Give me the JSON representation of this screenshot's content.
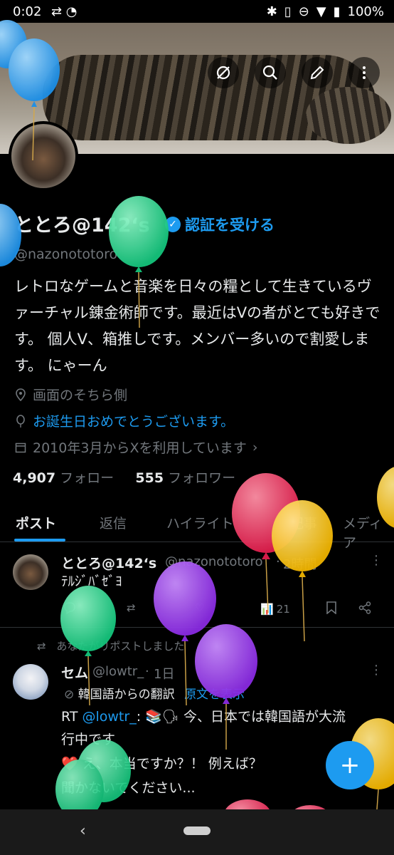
{
  "status_bar": {
    "time": "0:02",
    "battery": "100%"
  },
  "profile": {
    "name": "ととろ@142‘s",
    "verify_label": "認証を受ける",
    "handle": "@nazonototoro",
    "bio": "レトロなゲームと音楽を日々の糧として生きているヴァーチャル錬金術師です。最近はVの者がとても好きです。 個人V、箱推しです。メンバー多いので割愛します。 にゃーん",
    "location": "画面のそちら側",
    "birthday": "お誕生日おめでとうございます。",
    "joined": "2010年3月からXを利用しています",
    "following_count": "4,907",
    "following_label": "フォロー",
    "followers_count": "555",
    "followers_label": "フォロワー"
  },
  "tabs": [
    "ポスト",
    "返信",
    "ハイライト",
    "記事",
    "メディア"
  ],
  "post1": {
    "name": "ととろ@142‘s",
    "handle": "@nazonototoro",
    "time": "2時間",
    "text": "ﾃﾙｼﾞﾊﾞｾﾞﾖ",
    "views": "21"
  },
  "post2": {
    "repost_label": "あなたがリポストしました",
    "name": "セム",
    "handle": "@lowtr_",
    "time": "1日",
    "translate_label": "韓国語からの翻訳",
    "show_original": "原文を表示",
    "rt_prefix": "RT",
    "rt_handle": "@lowtr_",
    "line1_rest": ": 📚🗣 今、日本では韓国語が大流",
    "line2": "行中です",
    "line3": "❤️ え、本当ですか？！ 例えば？",
    "line4": "聞かないでください..."
  },
  "colors": {
    "accent": "#1d9bf0",
    "text": "#e7e9ea",
    "muted": "#71767b"
  }
}
